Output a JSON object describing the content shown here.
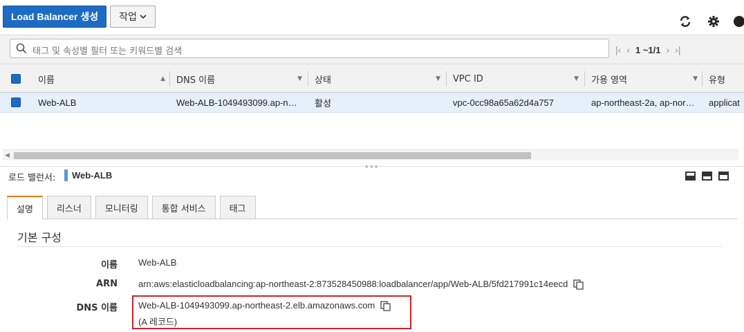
{
  "toolbar": {
    "create_label": "Load Balancer 생성",
    "actions_label": "작업",
    "icons": [
      "refresh-icon",
      "gear-icon",
      "help-icon"
    ]
  },
  "filter": {
    "placeholder": "태그 및 속성별 필터 또는 키워드별 검색",
    "pager_count": "1 ~1/1"
  },
  "table": {
    "columns": [
      "이름",
      "DNS 이름",
      "상태",
      "VPC ID",
      "가용 영역",
      "유형"
    ],
    "rows": [
      {
        "name": "Web-ALB",
        "dns": "Web-ALB-1049493099.ap-n…",
        "state": "활성",
        "vpc": "vpc-0cc98a65a62d4a757",
        "az": "ap-northeast-2a, ap-nor…",
        "type": "applicat"
      }
    ]
  },
  "detail": {
    "header_label": "로드 밸런서:",
    "header_name": "Web-ALB",
    "tabs": [
      "설명",
      "리스너",
      "모니터링",
      "통합 서비스",
      "태그"
    ],
    "active_tab": "설명",
    "section_title": "기본 구성",
    "fields": {
      "name_label": "이름",
      "name_value": "Web-ALB",
      "arn_label": "ARN",
      "arn_value": "arn:aws:elasticloadbalancing:ap-northeast-2:873528450988:loadbalancer/app/Web-ALB/5fd217991c14eecd",
      "dns_label": "DNS 이름",
      "dns_value": "Web-ALB-1049493099.ap-northeast-2.elb.amazonaws.com",
      "dns_record": "(A 레코드)"
    }
  },
  "colors": {
    "primary": "#1e6bc4",
    "row_selected": "#e6f0fa",
    "active_tab_accent": "#e47911",
    "highlight_border": "#d5202a"
  }
}
